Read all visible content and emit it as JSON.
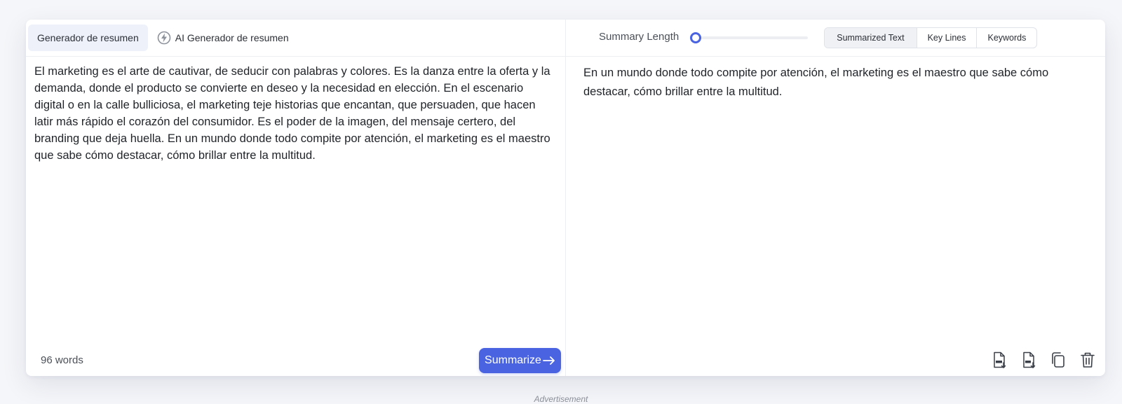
{
  "tabs": [
    {
      "label": "Generador de resumen"
    },
    {
      "label": "AI Generador de resumen"
    }
  ],
  "input": {
    "text": "El marketing es el arte de cautivar, de seducir con palabras y colores. Es la danza entre la oferta y la demanda, donde el producto se convierte en deseo y la necesidad en elección. En el escenario digital o en la calle bulliciosa, el marketing teje historias que encantan, que persuaden, que hacen latir más rápido el corazón del consumidor. Es el poder de la imagen, del mensaje certero, del branding que deja huella. En un mundo donde todo compite por atención, el marketing es el maestro que sabe cómo destacar, cómo brillar entre la multitud.",
    "word_count": "96 words"
  },
  "summarize_button": {
    "label": "Summarize"
  },
  "summary_length": {
    "label": "Summary Length",
    "level": 0
  },
  "output_modes": [
    "Summarized Text",
    "Key Lines",
    "Keywords"
  ],
  "output": {
    "text": "En un mundo donde todo compite por atención, el marketing es el maestro que sabe cómo destacar, cómo brillar entre la multitud."
  },
  "actions": [
    "doc-download-icon",
    "txt-download-icon",
    "copy-icon",
    "trash-icon"
  ],
  "ad_label": "Advertisement",
  "colors": {
    "accent": "#4a63e0"
  }
}
